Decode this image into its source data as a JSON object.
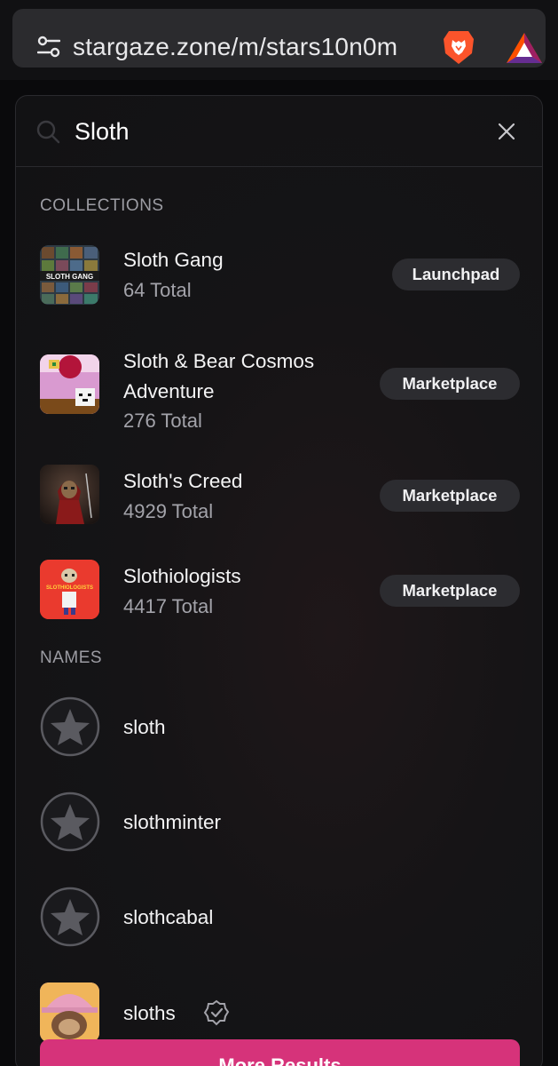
{
  "browser": {
    "url": "stargaze.zone/m/stars10n0m",
    "icons": [
      "tune-icon",
      "brave-lion-icon",
      "bat-triangle-icon"
    ]
  },
  "search": {
    "value": "Sloth",
    "icons": [
      "search-icon",
      "close-icon"
    ]
  },
  "collections": {
    "heading": "COLLECTIONS",
    "items": [
      {
        "name": "Sloth Gang",
        "total": "64 Total",
        "badge": "Launchpad"
      },
      {
        "name_line1": "Sloth & Bear Cosmos",
        "name_line2": "Adventure",
        "total": "276 Total",
        "badge": "Marketplace"
      },
      {
        "name": "Sloth's Creed",
        "total": "4929 Total",
        "badge": "Marketplace"
      },
      {
        "name": "Slothiologists",
        "total": "4417 Total",
        "badge": "Marketplace",
        "thumb_text": "SLOTHIOLOGISTS"
      }
    ],
    "sloth_gang_thumb_text": "SLOTH GANG"
  },
  "names": {
    "heading": "NAMES",
    "items": [
      {
        "name": "sloth",
        "icon": "star-avatar-icon"
      },
      {
        "name": "slothminter",
        "icon": "star-avatar-icon"
      },
      {
        "name": "slothcabal",
        "icon": "star-avatar-icon"
      },
      {
        "name": "sloths",
        "icon": "verified-badge-icon"
      }
    ]
  },
  "more_results": "More Results",
  "colors": {
    "accent": "#d6337a",
    "badge_bg": "#2c2c30",
    "panel_bg": "#151416"
  }
}
